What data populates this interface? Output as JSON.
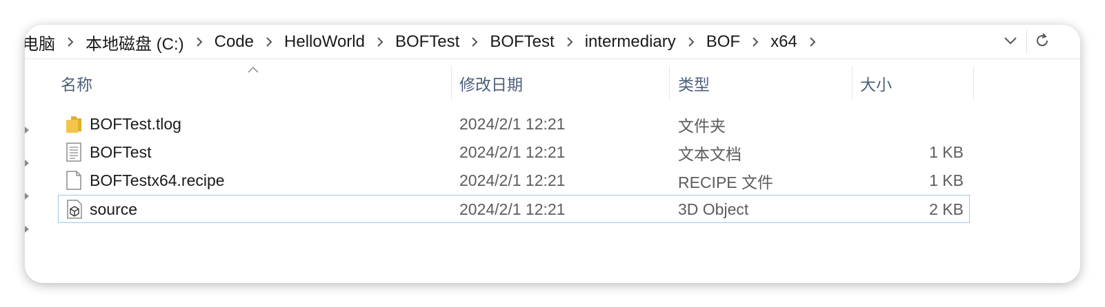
{
  "breadcrumb": {
    "items": [
      "电脑",
      "本地磁盘 (C:)",
      "Code",
      "HelloWorld",
      "BOFTest",
      "BOFTest",
      "intermediary",
      "BOF",
      "x64"
    ],
    "separator_icon": "chevron-right-icon"
  },
  "addressbar": {
    "dropdown_icon": "chevron-down-icon",
    "refresh_icon": "refresh-icon"
  },
  "columns": {
    "name": "名称",
    "date": "修改日期",
    "type": "类型",
    "size": "大小",
    "sorted_by": "名称"
  },
  "files": [
    {
      "name": "BOFTest.tlog",
      "date": "2024/2/1 12:21",
      "type": "文件夹",
      "size": "",
      "icon": "folder-icon",
      "selected": false
    },
    {
      "name": "BOFTest",
      "date": "2024/2/1 12:21",
      "type": "文本文档",
      "size": "1 KB",
      "icon": "text-document-icon",
      "selected": false
    },
    {
      "name": "BOFTestx64.recipe",
      "date": "2024/2/1 12:21",
      "type": "RECIPE 文件",
      "size": "1 KB",
      "icon": "blank-file-icon",
      "selected": false
    },
    {
      "name": "source",
      "date": "2024/2/1 12:21",
      "type": "3D Object",
      "size": "2 KB",
      "icon": "3d-object-icon",
      "selected": true
    }
  ],
  "colors": {
    "selection_border": "#99c8ea",
    "header_text": "#4c607a",
    "folder": "#f3c54a"
  }
}
